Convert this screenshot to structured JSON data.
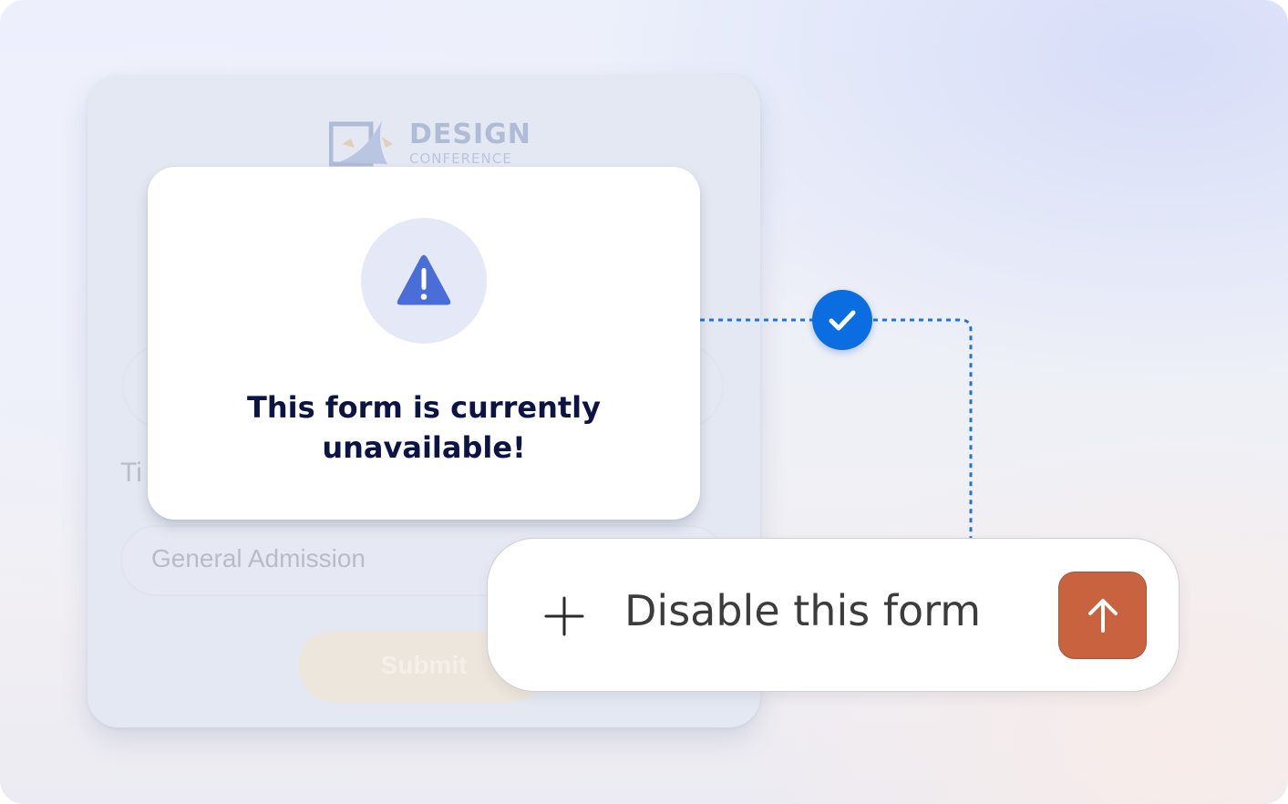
{
  "background_form": {
    "logo_line_1": "DESIGN",
    "logo_line_2": "CONFERENCE",
    "field_label": "Ti",
    "ticket_value": "General Admission",
    "submit_label": "Submit"
  },
  "popup": {
    "icon": "warning-triangle-icon",
    "message": "This form is currently unavailable!"
  },
  "connector": {
    "badge_icon": "checkmark-icon",
    "badge_color": "#0a6de0"
  },
  "command_bar": {
    "add_icon": "plus-icon",
    "text": "Disable this form",
    "send_icon": "arrow-up-icon",
    "send_color": "#c9623f"
  },
  "colors": {
    "warning_icon": "#4a6ed8",
    "warning_circle": "#e5e9f7",
    "message_text": "#0c1445"
  }
}
